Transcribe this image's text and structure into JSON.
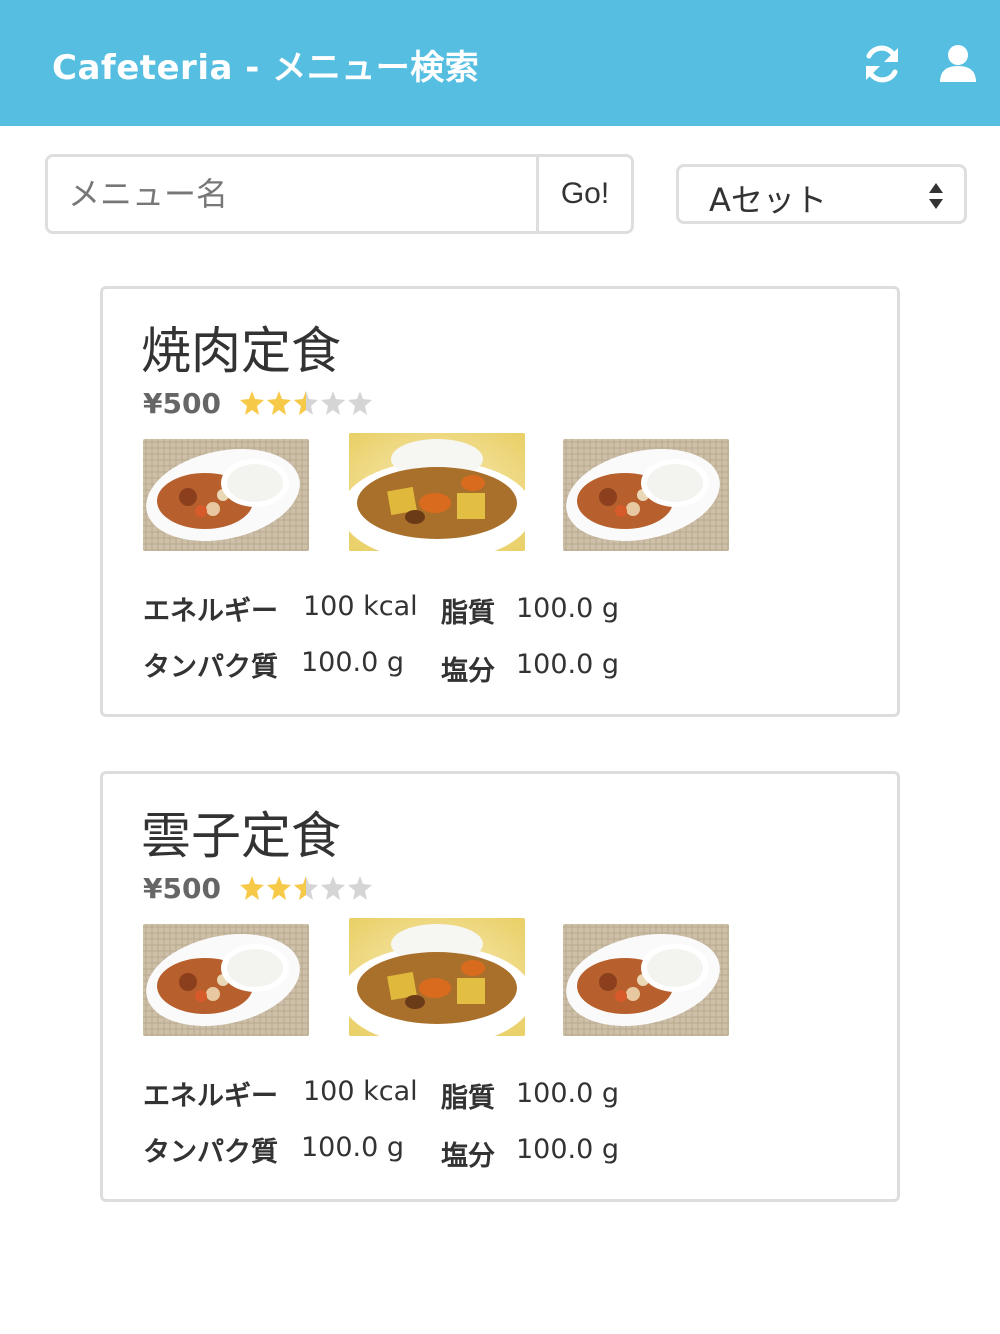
{
  "header": {
    "title": "Cafeteria - メニュー検索",
    "refresh_icon": "refresh-icon",
    "user_icon": "user-icon",
    "bg_color": "#56bfe1"
  },
  "search": {
    "placeholder": "メニュー名",
    "value": "",
    "go_label": "Go!"
  },
  "set_select": {
    "selected": "Aセット"
  },
  "menu_items": [
    {
      "name": "焼肉定食",
      "price": "¥500",
      "rating": 2.5,
      "rating_max": 5,
      "photos": [
        "curry-rice-photo",
        "curry-bowl-photo",
        "curry-rice-photo"
      ],
      "nutrition": {
        "energy_label": "エネルギー",
        "energy": "100 kcal",
        "fat_label": "脂質",
        "fat": "100.0 g",
        "protein_label": "タンパク質",
        "protein": "100.0 g",
        "salt_label": "塩分",
        "salt": "100.0 g"
      }
    },
    {
      "name": "雲子定食",
      "price": "¥500",
      "rating": 2.5,
      "rating_max": 5,
      "photos": [
        "curry-rice-photo",
        "curry-bowl-photo",
        "curry-rice-photo"
      ],
      "nutrition": {
        "energy_label": "エネルギー",
        "energy": "100 kcal",
        "fat_label": "脂質",
        "fat": "100.0 g",
        "protein_label": "タンパク質",
        "protein": "100.0 g",
        "salt_label": "塩分",
        "salt": "100.0 g"
      }
    }
  ],
  "colors": {
    "star_filled": "#f7c948",
    "star_empty": "#d5d5d5"
  }
}
